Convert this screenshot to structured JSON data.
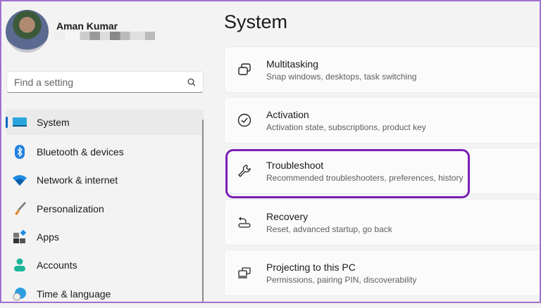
{
  "user": {
    "name": "Aman Kumar"
  },
  "search": {
    "placeholder": "Find a setting"
  },
  "nav": [
    {
      "label": "System",
      "icon": "system-icon",
      "selected": true
    },
    {
      "label": "Bluetooth & devices",
      "icon": "bluetooth-icon"
    },
    {
      "label": "Network & internet",
      "icon": "wifi-icon"
    },
    {
      "label": "Personalization",
      "icon": "brush-icon"
    },
    {
      "label": "Apps",
      "icon": "apps-icon"
    },
    {
      "label": "Accounts",
      "icon": "account-icon"
    },
    {
      "label": "Time & language",
      "icon": "globe-clock-icon"
    }
  ],
  "page_title": "System",
  "cards": [
    {
      "title": "Multitasking",
      "sub": "Snap windows, desktops, task switching",
      "icon": "multitasking-icon"
    },
    {
      "title": "Activation",
      "sub": "Activation state, subscriptions, product key",
      "icon": "check-circle-icon"
    },
    {
      "title": "Troubleshoot",
      "sub": "Recommended troubleshooters, preferences, history",
      "icon": "wrench-icon",
      "highlighted": true
    },
    {
      "title": "Recovery",
      "sub": "Reset, advanced startup, go back",
      "icon": "recovery-icon"
    },
    {
      "title": "Projecting to this PC",
      "sub": "Permissions, pairing PIN, discoverability",
      "icon": "projecting-icon"
    }
  ],
  "colors": {
    "accent": "#0067c0",
    "highlight": "#7a1fb5"
  }
}
